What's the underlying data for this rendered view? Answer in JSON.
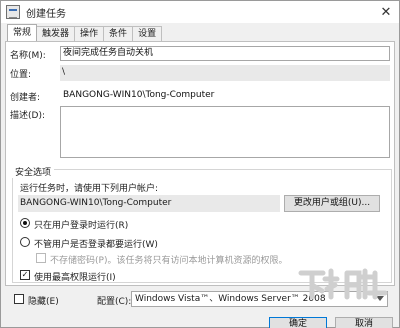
{
  "window": {
    "title": "创建任务",
    "close_glyph": "✕"
  },
  "tabs": [
    {
      "label": "常规",
      "active": true
    },
    {
      "label": "触发器",
      "active": false
    },
    {
      "label": "操作",
      "active": false
    },
    {
      "label": "条件",
      "active": false
    },
    {
      "label": "设置",
      "active": false
    }
  ],
  "general": {
    "name_label": "名称(M):",
    "name_value": "夜间完成任务自动关机",
    "location_label": "位置:",
    "location_value": "\\",
    "author_label": "创建者:",
    "author_value": "BANGONG-WIN10\\Tong-Computer",
    "description_label": "描述(D):",
    "description_value": ""
  },
  "security": {
    "group_title": "安全选项",
    "run_as_prompt": "运行任务时，请使用下列用户帐户:",
    "user_account": "BANGONG-WIN10\\Tong-Computer",
    "change_user_button": "更改用户或组(U)...",
    "radio_logged_on": "只在用户登录时运行(R)",
    "radio_logged_on_checked": true,
    "radio_whether_logged": "不管用户是否登录都要运行(W)",
    "radio_whether_logged_checked": false,
    "no_store_password": "不存储密码(P)。该任务将只有访问本地计算机资源的权限。",
    "no_store_password_checked": false,
    "highest_privileges": "使用最高权限运行(I)",
    "highest_privileges_checked": true
  },
  "footer": {
    "hidden_label": "隐藏(E)",
    "hidden_checked": false,
    "configure_label": "配置(C):",
    "configure_value": "Windows Vista™、Windows Server™ 2008",
    "ok_button": "确定",
    "cancel_button": "取消"
  },
  "watermark_text": "下载吧",
  "colors": {
    "accent": "#0078d7",
    "window_bg": "#f0f0f0",
    "panel_bg": "#ffffff",
    "readonly_bg": "#e9e9e9",
    "watermark": "#d0d0d0"
  },
  "icons": {
    "app": "task-scheduler-icon",
    "close": "close-icon",
    "dropdown": "chevron-down-icon"
  }
}
